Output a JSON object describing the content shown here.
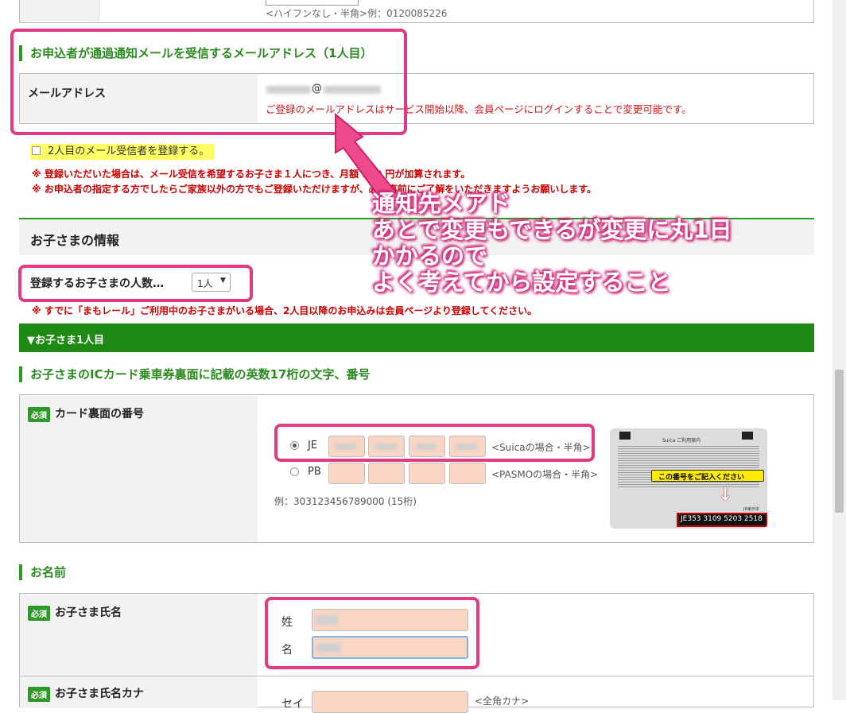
{
  "top_phone": {
    "hint": "<ハイフンなし・半角>例：0120085226"
  },
  "email_section": {
    "title": "お申込者が通過通知メールを受信するメールアドレス（1人目）",
    "field_label": "メールアドレス",
    "value_at": "@",
    "notice": "ご登録のメールアドレスはサービス開始以降、会員ページにログインすることで変更可能です。"
  },
  "second_receiver": {
    "checkbox_label": "2人目のメール受信者を登録する。",
    "note1": "※ 登録いただいた場合は、メール受信を希望するお子さま１人につき、月額 100 円が加算されます。",
    "note2": "※ お申込者の指定する方でしたらご家族以外の方でもご登録いただけますが、必ず事前にご了解をいただきますようお願いします。"
  },
  "children_section": {
    "heading": "お子さまの情報",
    "count_label": "登録するお子さまの人数…",
    "count_value": "1人",
    "count_note": "※ すでに「まもレール」ご利用中のお子さまがいる場合、2人目以降のお申込みは会員ページより登録してください。",
    "child1_bar": "▼お子さま1人目"
  },
  "ic_section": {
    "title": "お子さまのICカード乗車券裏面に記載の英数17桁の文字、番号",
    "required_badge": "必須",
    "label": "カード裏面の番号",
    "je_label": "JE",
    "je_hint": "<Suicaの場合・半角>",
    "pb_label": "PB",
    "pb_hint": "<PASMOの場合・半角>",
    "example": "例：303123456789000 (15桁)",
    "card_banner": "この番号をご記入ください",
    "card_number": "JE353 3109 5203 2518",
    "card_header": "Suica ご利用案内",
    "card_company": "JR東日本"
  },
  "name_section": {
    "title": "お名前",
    "required_badge": "必須",
    "name_label": "お子さま氏名",
    "sei_label": "姓",
    "mei_label": "名",
    "kana_label": "お子さま氏名カナ",
    "kana_sei_label": "セイ",
    "kana_hint": "<全角カナ>"
  },
  "annotation": {
    "lines": [
      "通知先メアド",
      "あとで変更もできるが変更に丸1日",
      "かかるので",
      "よく考えてから設定すること"
    ]
  },
  "colors": {
    "accent_green": "#2c9a24",
    "highlight_pink": "#e23a82",
    "input_fill": "#f9d6c3",
    "notice_red": "#d0161a"
  }
}
